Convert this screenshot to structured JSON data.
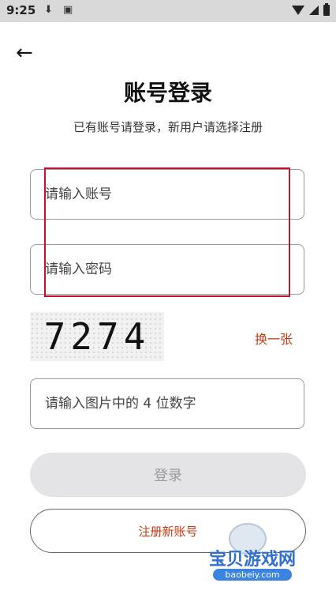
{
  "status_bar": {
    "time": "9:25",
    "download_icon": "download-icon",
    "notification_icon": "a-icon"
  },
  "header": {
    "back_icon": "arrow-left-icon",
    "title": "账号登录",
    "subtitle": "已有账号请登录，新用户请选择注册"
  },
  "form": {
    "account_placeholder": "请输入账号",
    "password_placeholder": "请输入密码",
    "captcha_image_text": "7274",
    "refresh_label": "换一张",
    "captcha_placeholder": "请输入图片中的 4 位数字"
  },
  "buttons": {
    "login_label": "登录",
    "register_label": "注册新账号"
  },
  "watermark": {
    "name": "宝贝游戏网",
    "url": "baobeiy.com"
  },
  "colors": {
    "accent": "#c43b10",
    "highlight_box": "#c8102e",
    "disabled_button": "#e4e3e6"
  }
}
